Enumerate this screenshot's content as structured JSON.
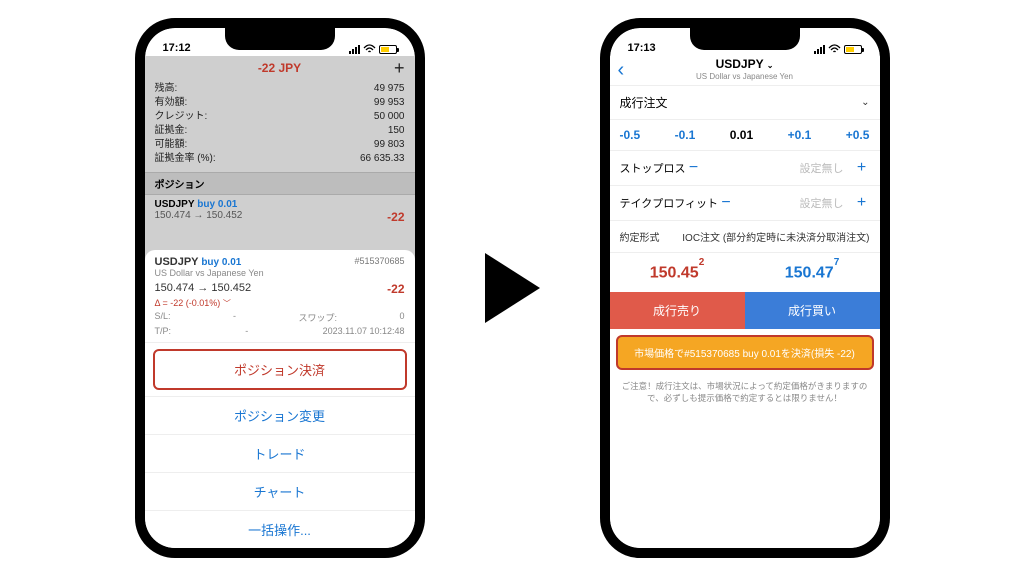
{
  "left": {
    "status_time": "17:12",
    "title": "-22 JPY",
    "account": {
      "rows": [
        {
          "label": "残高:",
          "value": "49 975"
        },
        {
          "label": "有効額:",
          "value": "99 953"
        },
        {
          "label": "クレジット:",
          "value": "50 000"
        },
        {
          "label": "証拠金:",
          "value": "150"
        },
        {
          "label": "可能額:",
          "value": "99 803"
        },
        {
          "label": "証拠金率 (%):",
          "value": "66 635.33"
        }
      ]
    },
    "positions_header": "ポジション",
    "pos": {
      "symbol": "USDJPY",
      "side": "buy 0.01",
      "prices": "150.474 → 150.452",
      "pl": "-22"
    },
    "sheet": {
      "symbol": "USDJPY",
      "side": "buy 0.01",
      "id": "#515370685",
      "desc": "US Dollar vs Japanese Yen",
      "prices": "150.474 → 150.452",
      "pl": "-22",
      "delta": "Δ = -22 (-0.01%)",
      "sl_label": "S/L:",
      "sl_val": "-",
      "swap_label": "スワップ:",
      "swap_val": "0",
      "tp_label": "T/P:",
      "tp_val": "-",
      "ts_label": "",
      "ts_val": "2023.11.07 10:12:48",
      "menu": {
        "close": "ポジション決済",
        "modify": "ポジション変更",
        "trade": "トレード",
        "chart": "チャート",
        "bulk": "一括操作..."
      }
    }
  },
  "right": {
    "status_time": "17:13",
    "nav_title": "USDJPY",
    "nav_sub": "US Dollar vs Japanese Yen",
    "order_type": "成行注文",
    "steps": {
      "m05": "-0.5",
      "m01": "-0.1",
      "cur": "0.01",
      "p01": "+0.1",
      "p05": "+0.5"
    },
    "sl_label": "ストップロス",
    "tp_label": "テイクプロフィット",
    "unset": "設定無し",
    "ioc_label": "約定形式",
    "ioc_value": "IOC注文 (部分約定時に未決済分取消注文)",
    "bid_main": "150.45",
    "bid_sup": "2",
    "ask_main": "150.47",
    "ask_sup": "7",
    "sell_btn": "成行売り",
    "buy_btn": "成行買い",
    "close_bar": "市場価格で#515370685 buy 0.01を決済(損失 -22)",
    "disclaimer": "ご注意！成行注文は、市場状況によって約定価格がきまりますので、必ずしも提示価格で約定するとは限りません！"
  }
}
